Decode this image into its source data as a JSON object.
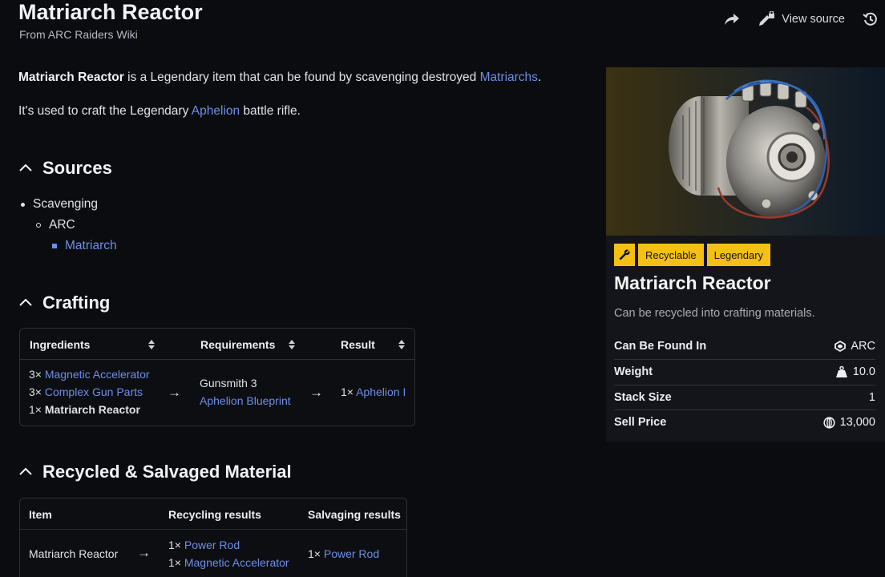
{
  "header": {
    "title": "Matriarch Reactor",
    "subtitle": "From ARC Raiders Wiki",
    "view_source": "View source"
  },
  "intro": {
    "p1_bold": "Matriarch Reactor",
    "p1_text": " is a Legendary item that can be found by scavenging destroyed ",
    "p1_link": "Matriarchs",
    "p1_end": ".",
    "p2_text": "It's used to craft the Legendary ",
    "p2_link": "Aphelion",
    "p2_end": " battle rifle."
  },
  "sources": {
    "heading": "Sources",
    "items": [
      "Scavenging",
      "ARC",
      "Matriarch"
    ]
  },
  "crafting": {
    "heading": "Crafting",
    "columns": [
      "Ingredients",
      "Requirements",
      "Result"
    ],
    "ingredients": [
      {
        "qty": "3×",
        "name": "Magnetic Accelerator"
      },
      {
        "qty": "3×",
        "name": "Complex Gun Parts"
      },
      {
        "qty": "1×",
        "name": "Matriarch Reactor"
      }
    ],
    "requirements": [
      "Gunsmith 3",
      "Aphelion Blueprint"
    ],
    "result": {
      "qty": "1×",
      "name": "Aphelion I"
    },
    "arrow": "→"
  },
  "recycled": {
    "heading": "Recycled & Salvaged Material",
    "columns": [
      "Item",
      "Recycling results",
      "Salvaging results"
    ],
    "item": "Matriarch Reactor",
    "arrow": "→",
    "recycling": [
      {
        "qty": "1×",
        "name": "Power Rod"
      },
      {
        "qty": "1×",
        "name": "Magnetic Accelerator"
      }
    ],
    "salvaging": [
      {
        "qty": "1×",
        "name": "Power Rod"
      }
    ]
  },
  "infobox": {
    "tags": [
      "Recyclable",
      "Legendary"
    ],
    "tag_icon": "wrench-icon",
    "title": "Matriarch Reactor",
    "description": "Can be recycled into crafting materials.",
    "rows": [
      {
        "key": "Can Be Found In",
        "value": "ARC",
        "icon": "arc-icon"
      },
      {
        "key": "Weight",
        "value": "10.0",
        "icon": "weight-icon"
      },
      {
        "key": "Stack Size",
        "value": "1",
        "icon": ""
      },
      {
        "key": "Sell Price",
        "value": "13,000",
        "icon": "coin-icon"
      }
    ],
    "colors": {
      "tag_bg": "#f4c014",
      "link": "#6d8fe8"
    }
  }
}
